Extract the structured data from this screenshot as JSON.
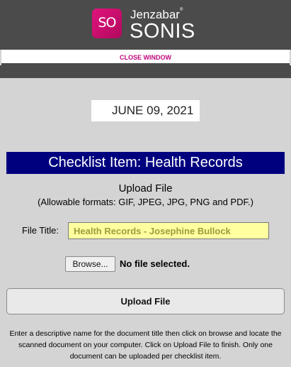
{
  "brand": {
    "logo_text": "SO",
    "name_top": "Jenzabar",
    "trademark": "®",
    "name_bottom": "SONIS"
  },
  "close_window_label": "CLOSE WINDOW",
  "date": "JUNE 09, 2021",
  "header": "Checklist Item: Health Records",
  "upload": {
    "title": "Upload File",
    "formats": "(Allowable formats: GIF, JPEG, JPG, PNG and PDF.)"
  },
  "file_title": {
    "label": "File Title:",
    "value": "Health Records - Josephine Bullock"
  },
  "browse_label": "Browse...",
  "no_file_text": "No file selected.",
  "upload_button_label": "Upload File",
  "instructions": "Enter a descriptive name for the document title then click on browse and locate the scanned document on your computer. Click on Upload File to finish. Only one document can be uploaded per checklist item.",
  "colors": {
    "header_bg": "#00007f",
    "accent_link": "#c0067c",
    "input_bg": "#ffffa0"
  }
}
